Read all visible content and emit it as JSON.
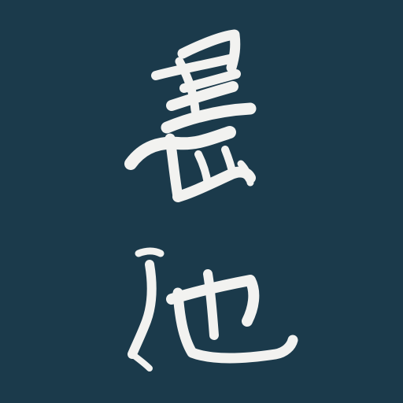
{
  "icon": {
    "logo_text": "墨池",
    "background_color": "#1b3a4b",
    "ink_color": "#f2f2f0"
  }
}
